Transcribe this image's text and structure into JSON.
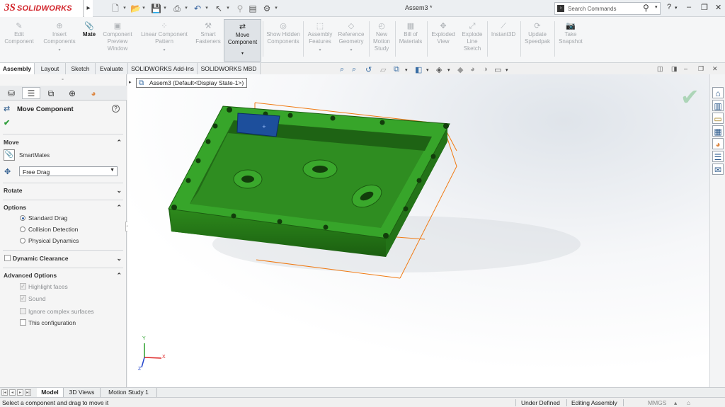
{
  "app": {
    "logo_ds": "3S",
    "logo_text": "SOLIDWORKS",
    "document_title": "Assem3 *"
  },
  "search": {
    "placeholder": "Search Commands"
  },
  "quick_access": {
    "items": [
      "new-icon",
      "open-icon",
      "save-icon",
      "print-icon",
      "undo-icon",
      "select-icon",
      "rebuild-icon",
      "file-properties-icon",
      "options-icon"
    ]
  },
  "window_controls": {
    "help": "?",
    "minimize": "–",
    "restore": "❐",
    "close": "✕"
  },
  "ribbon": {
    "buttons": [
      {
        "label": "Edit Component",
        "enabled": false
      },
      {
        "label": "Insert Components",
        "enabled": false
      },
      {
        "label": "Mate",
        "enabled": true
      },
      {
        "label": "Component Preview Window",
        "enabled": false
      },
      {
        "label": "Linear Component Pattern",
        "enabled": false
      },
      {
        "label": "Smart Fasteners",
        "enabled": false
      },
      {
        "label": "Move Component",
        "enabled": true,
        "selected": true
      },
      {
        "label": "Show Hidden Components",
        "enabled": false
      },
      {
        "label": "Assembly Features",
        "enabled": false
      },
      {
        "label": "Reference Geometry",
        "enabled": false
      },
      {
        "label": "New Motion Study",
        "enabled": false
      },
      {
        "label": "Bill of Materials",
        "enabled": false
      },
      {
        "label": "Exploded View",
        "enabled": false
      },
      {
        "label": "Explode Line Sketch",
        "enabled": false
      },
      {
        "label": "Instant3D",
        "enabled": false
      },
      {
        "label": "Update Speedpak",
        "enabled": false
      },
      {
        "label": "Take Snapshot",
        "enabled": false
      }
    ]
  },
  "command_tabs": [
    "Assembly",
    "Layout",
    "Sketch",
    "Evaluate",
    "SOLIDWORKS Add-Ins",
    "SOLIDWORKS MBD"
  ],
  "active_command_tab": "Assembly",
  "breadcrumb": {
    "text": "Assem3  (Default<Display State-1>)"
  },
  "property_manager": {
    "title": "Move Component",
    "help": "?",
    "ok": "✔",
    "move": {
      "header": "Move",
      "smartmates_label": "SmartMates",
      "drag_mode": "Free Drag"
    },
    "rotate": {
      "header": "Rotate"
    },
    "options": {
      "header": "Options",
      "radios": [
        {
          "label": "Standard Drag",
          "checked": true
        },
        {
          "label": "Collision Detection",
          "checked": false
        },
        {
          "label": "Physical Dynamics",
          "checked": false
        }
      ]
    },
    "dynamic_clearance": {
      "header": "Dynamic Clearance",
      "checked": false
    },
    "advanced": {
      "header": "Advanced Options",
      "checks": [
        {
          "label": "Highlight faces",
          "checked": true,
          "enabled": false
        },
        {
          "label": "Sound",
          "checked": true,
          "enabled": false
        },
        {
          "label": "Ignore complex surfaces",
          "checked": false,
          "enabled": false
        },
        {
          "label": "This configuration",
          "checked": false,
          "enabled": true
        }
      ]
    }
  },
  "bottom_tabs": [
    "Model",
    "3D Views",
    "Motion Study 1"
  ],
  "status_bar": {
    "message": "Select a component and drag to move it",
    "definition": "Under Defined",
    "mode": "Editing Assembly",
    "units": "MMGS"
  },
  "colors": {
    "part_green": "#2f8a1f",
    "bbox_orange": "#f07a12",
    "selected_face": "#1d4f9c",
    "accent_blue": "#3a6ea5"
  },
  "triad": {
    "x": "X",
    "y": "Y",
    "z": "Z"
  }
}
